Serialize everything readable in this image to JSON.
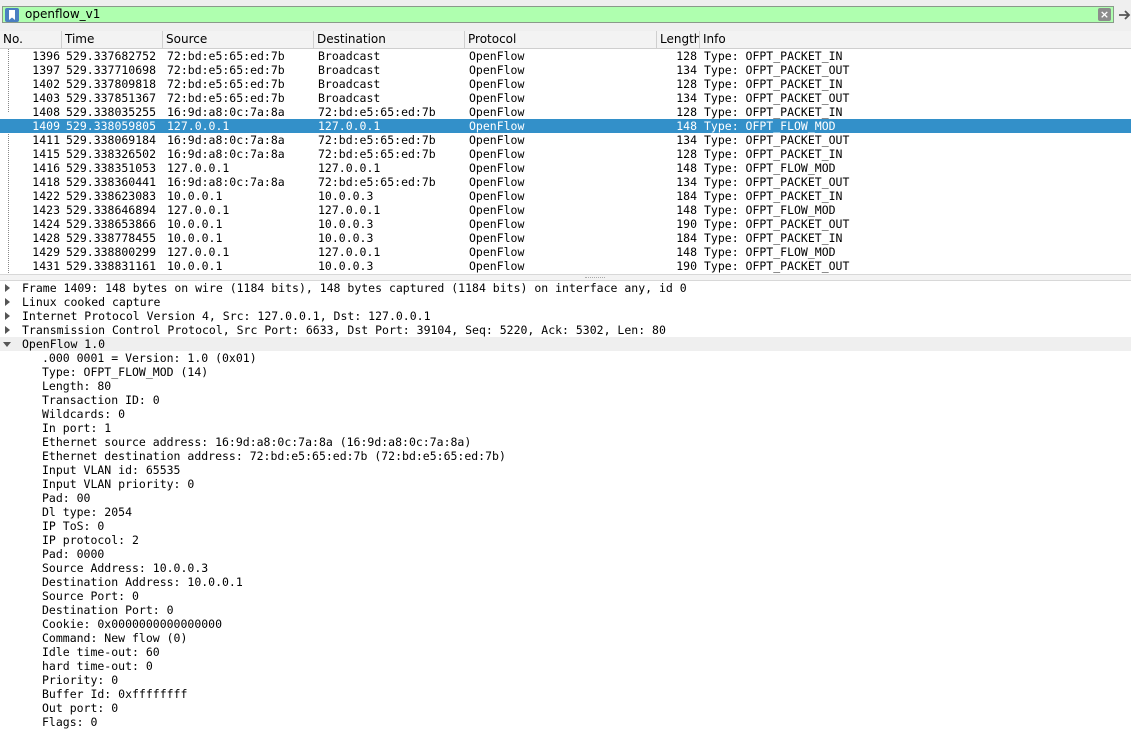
{
  "filter": {
    "value": "openflow_v1",
    "clear_icon": "clear-x-icon",
    "bookmark_icon": "bookmark-icon",
    "apply_icon": "apply-arrow-icon"
  },
  "columns": [
    "No.",
    "Time",
    "Source",
    "Destination",
    "Protocol",
    "Length",
    "Info"
  ],
  "packets": [
    {
      "no": "1396",
      "time": "529.337682752",
      "src": "72:bd:e5:65:ed:7b",
      "dst": "Broadcast",
      "proto": "OpenFlow",
      "len": "128",
      "info": "Type: OFPT_PACKET_IN"
    },
    {
      "no": "1397",
      "time": "529.337710698",
      "src": "72:bd:e5:65:ed:7b",
      "dst": "Broadcast",
      "proto": "OpenFlow",
      "len": "134",
      "info": "Type: OFPT_PACKET_OUT"
    },
    {
      "no": "1402",
      "time": "529.337809818",
      "src": "72:bd:e5:65:ed:7b",
      "dst": "Broadcast",
      "proto": "OpenFlow",
      "len": "128",
      "info": "Type: OFPT_PACKET_IN"
    },
    {
      "no": "1403",
      "time": "529.337851367",
      "src": "72:bd:e5:65:ed:7b",
      "dst": "Broadcast",
      "proto": "OpenFlow",
      "len": "134",
      "info": "Type: OFPT_PACKET_OUT"
    },
    {
      "no": "1408",
      "time": "529.338035255",
      "src": "16:9d:a8:0c:7a:8a",
      "dst": "72:bd:e5:65:ed:7b",
      "proto": "OpenFlow",
      "len": "128",
      "info": "Type: OFPT_PACKET_IN"
    },
    {
      "no": "1409",
      "time": "529.338059805",
      "src": "127.0.0.1",
      "dst": "127.0.0.1",
      "proto": "OpenFlow",
      "len": "148",
      "info": "Type: OFPT_FLOW_MOD",
      "selected": true
    },
    {
      "no": "1411",
      "time": "529.338069184",
      "src": "16:9d:a8:0c:7a:8a",
      "dst": "72:bd:e5:65:ed:7b",
      "proto": "OpenFlow",
      "len": "134",
      "info": "Type: OFPT_PACKET_OUT"
    },
    {
      "no": "1415",
      "time": "529.338326502",
      "src": "16:9d:a8:0c:7a:8a",
      "dst": "72:bd:e5:65:ed:7b",
      "proto": "OpenFlow",
      "len": "128",
      "info": "Type: OFPT_PACKET_IN"
    },
    {
      "no": "1416",
      "time": "529.338351053",
      "src": "127.0.0.1",
      "dst": "127.0.0.1",
      "proto": "OpenFlow",
      "len": "148",
      "info": "Type: OFPT_FLOW_MOD"
    },
    {
      "no": "1418",
      "time": "529.338360441",
      "src": "16:9d:a8:0c:7a:8a",
      "dst": "72:bd:e5:65:ed:7b",
      "proto": "OpenFlow",
      "len": "134",
      "info": "Type: OFPT_PACKET_OUT"
    },
    {
      "no": "1422",
      "time": "529.338623083",
      "src": "10.0.0.1",
      "dst": "10.0.0.3",
      "proto": "OpenFlow",
      "len": "184",
      "info": "Type: OFPT_PACKET_IN"
    },
    {
      "no": "1423",
      "time": "529.338646894",
      "src": "127.0.0.1",
      "dst": "127.0.0.1",
      "proto": "OpenFlow",
      "len": "148",
      "info": "Type: OFPT_FLOW_MOD"
    },
    {
      "no": "1424",
      "time": "529.338653866",
      "src": "10.0.0.1",
      "dst": "10.0.0.3",
      "proto": "OpenFlow",
      "len": "190",
      "info": "Type: OFPT_PACKET_OUT"
    },
    {
      "no": "1428",
      "time": "529.338778455",
      "src": "10.0.0.1",
      "dst": "10.0.0.3",
      "proto": "OpenFlow",
      "len": "184",
      "info": "Type: OFPT_PACKET_IN"
    },
    {
      "no": "1429",
      "time": "529.338800299",
      "src": "127.0.0.1",
      "dst": "127.0.0.1",
      "proto": "OpenFlow",
      "len": "148",
      "info": "Type: OFPT_FLOW_MOD"
    },
    {
      "no": "1431",
      "time": "529.338831161",
      "src": "10.0.0.1",
      "dst": "10.0.0.3",
      "proto": "OpenFlow",
      "len": "190",
      "info": "Type: OFPT_PACKET_OUT"
    }
  ],
  "details": {
    "sections": [
      {
        "text": "Frame 1409: 148 bytes on wire (1184 bits), 148 bytes captured (1184 bits) on interface any, id 0",
        "expanded": false
      },
      {
        "text": "Linux cooked capture",
        "expanded": false
      },
      {
        "text": "Internet Protocol Version 4, Src: 127.0.0.1, Dst: 127.0.0.1",
        "expanded": false
      },
      {
        "text": "Transmission Control Protocol, Src Port: 6633, Dst Port: 39104, Seq: 5220, Ack: 5302, Len: 80",
        "expanded": false
      },
      {
        "text": "OpenFlow 1.0",
        "expanded": true
      }
    ],
    "fields": [
      ".000 0001 = Version: 1.0 (0x01)",
      "Type: OFPT_FLOW_MOD (14)",
      "Length: 80",
      "Transaction ID: 0",
      "Wildcards: 0",
      "In port: 1",
      "Ethernet source address: 16:9d:a8:0c:7a:8a (16:9d:a8:0c:7a:8a)",
      "Ethernet destination address: 72:bd:e5:65:ed:7b (72:bd:e5:65:ed:7b)",
      "Input VLAN id: 65535",
      "Input VLAN priority: 0",
      "Pad: 00",
      "Dl type: 2054",
      "IP ToS: 0",
      "IP protocol: 2",
      "Pad: 0000",
      "Source Address: 10.0.0.3",
      "Destination Address: 10.0.0.1",
      "Source Port: 0",
      "Destination Port: 0",
      "Cookie: 0x0000000000000000",
      "Command: New flow (0)",
      "Idle time-out: 60",
      "hard time-out: 0",
      "Priority: 0",
      "Buffer Id: 0xffffffff",
      "Out port: 0",
      "Flags: 0"
    ]
  },
  "colors": {
    "filter_valid": "#afffaf",
    "selection": "#3390c9"
  }
}
